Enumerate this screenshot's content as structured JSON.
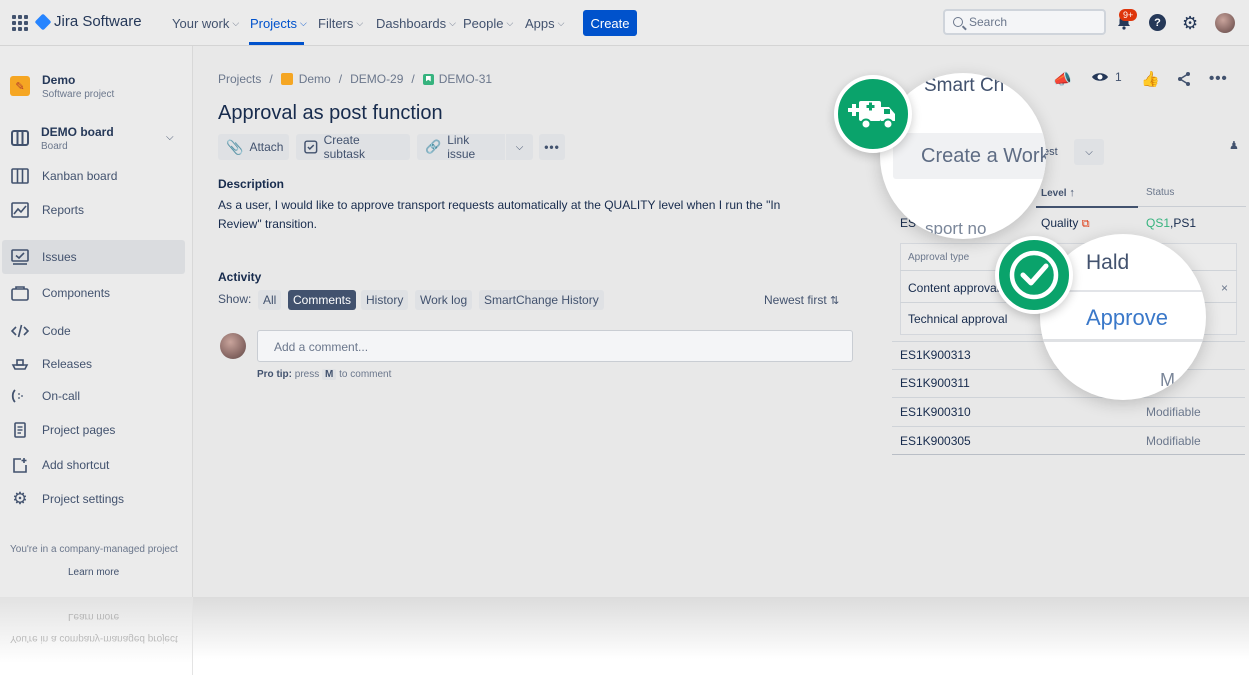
{
  "topnav": {
    "app_name": "Jira Software",
    "items": [
      {
        "label": "Your work"
      },
      {
        "label": "Projects"
      },
      {
        "label": "Filters"
      },
      {
        "label": "Dashboards"
      },
      {
        "label": "People"
      },
      {
        "label": "Apps"
      }
    ],
    "create_label": "Create",
    "search_placeholder": "Search",
    "notif_badge": "9+",
    "help_glyph": "?"
  },
  "sidebar": {
    "project_name": "Demo",
    "project_type": "Software project",
    "board_name": "DEMO board",
    "board_sub": "Board",
    "items": [
      {
        "label": "Kanban board",
        "icon": "kanban-icon"
      },
      {
        "label": "Reports",
        "icon": "reports-icon"
      },
      {
        "label": "Issues",
        "icon": "issues-icon"
      },
      {
        "label": "Components",
        "icon": "components-icon"
      },
      {
        "label": "Code",
        "icon": "code-icon"
      },
      {
        "label": "Releases",
        "icon": "releases-icon"
      },
      {
        "label": "On-call",
        "icon": "on-call-icon"
      },
      {
        "label": "Project pages",
        "icon": "project-pages-icon"
      },
      {
        "label": "Add shortcut",
        "icon": "add-shortcut-icon"
      },
      {
        "label": "Project settings",
        "icon": "gear-icon"
      }
    ],
    "footer_note": "You're in a company-managed project",
    "learn_more": "Learn more"
  },
  "breadcrumb": {
    "items": [
      "Projects",
      "Demo",
      "DEMO-29",
      "DEMO-31"
    ],
    "sep": "/"
  },
  "issue": {
    "title": "Approval as post function",
    "toolbar": {
      "attach": "Attach",
      "create_subtask": "Create subtask",
      "link_issue": "Link issue"
    },
    "description_heading": "Description",
    "description_text": "As a user, I would like to approve transport requests automatically at the QUALITY level when I run the \"In Review\" transition.",
    "activity_heading": "Activity",
    "show_label": "Show:",
    "filters": [
      "All",
      "Comments",
      "History",
      "Work log",
      "SmartChange History"
    ],
    "active_filter": "Comments",
    "sort_label": "Newest first",
    "comment_placeholder": "Add a comment...",
    "pro_tip_bold": "Pro tip:",
    "pro_tip_press": "press",
    "pro_tip_key": "M",
    "pro_tip_rest": "to comment",
    "watch_count": "1"
  },
  "right_panel": {
    "est_label": "est",
    "col_level": "Level",
    "col_status": "Status",
    "first_row": {
      "id": "ES",
      "level": "Quality",
      "status_green": "QS1",
      "status_rest": ",PS1"
    },
    "approval_type_header": "Approval type",
    "approval_types": [
      "Content approval",
      "Technical approval"
    ],
    "close_glyph": "×",
    "rows": [
      {
        "id": "ES1K900313",
        "status": ""
      },
      {
        "id": "ES1K900311",
        "status": ""
      },
      {
        "id": "ES1K900310",
        "status": "Modifiable"
      },
      {
        "id": "ES1K900305",
        "status": "Modifiable"
      }
    ]
  },
  "zoom_top": {
    "peek_title": "Smart Ch",
    "button": "Create a Work",
    "peek_bottom": "sport no"
  },
  "zoom_bottom": {
    "option_hold": "Hald",
    "option_approve": "Approve",
    "peek_bottom": "M"
  },
  "reflection": {
    "learn_more": "Learn more",
    "footer_note": "You're in a company-managed project"
  },
  "colors": {
    "accent": "#0052cc",
    "badge_green": "#0aa36b",
    "approve_blue": "#3a78c9"
  }
}
